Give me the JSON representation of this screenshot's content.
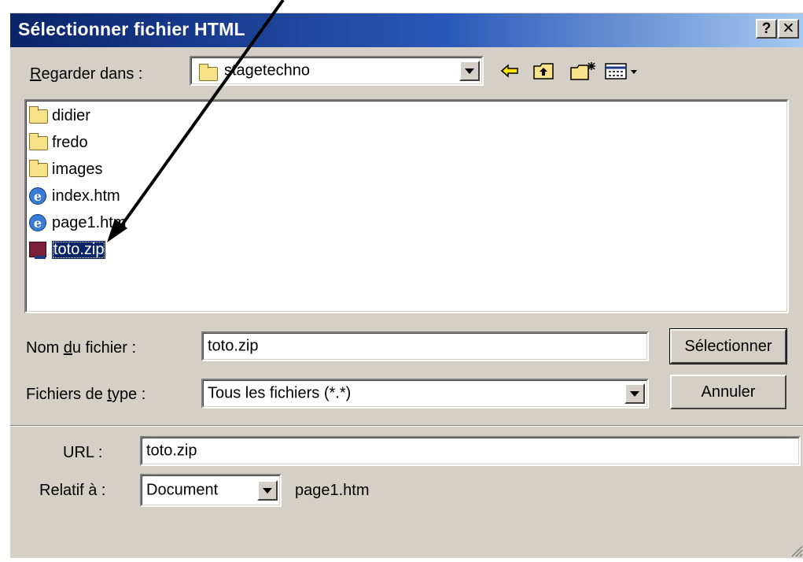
{
  "window": {
    "title": "Sélectionner fichier HTML",
    "help_button": "?",
    "close_button": "✕"
  },
  "look_in": {
    "label_prefix": "R",
    "label_rest": "egarder dans :",
    "value": "stagetechno"
  },
  "toolbar": {
    "back_icon": "back-arrow-icon",
    "up_icon": "up-folder-icon",
    "new_folder_icon": "new-folder-icon",
    "view_icon": "view-menu-icon"
  },
  "files": [
    {
      "name": "didier",
      "type": "folder"
    },
    {
      "name": "fredo",
      "type": "folder"
    },
    {
      "name": "images",
      "type": "folder"
    },
    {
      "name": "index.htm",
      "type": "html"
    },
    {
      "name": "page1.htm",
      "type": "html"
    },
    {
      "name": "toto.zip",
      "type": "zip",
      "selected": true
    }
  ],
  "filename": {
    "label_a": "Nom ",
    "label_ul": "d",
    "label_b": "u fichier :",
    "value": "toto.zip"
  },
  "filetype": {
    "label_a": "Fichiers de ",
    "label_ul": "t",
    "label_b": "ype :",
    "value": "Tous les fichiers (*.*)"
  },
  "buttons": {
    "select": "Sélectionner",
    "cancel": "Annuler"
  },
  "url": {
    "label": "URL :",
    "value": "toto.zip"
  },
  "relative": {
    "label": "Relatif à :",
    "value": "Document",
    "file": "page1.htm"
  },
  "colors": {
    "title_bar": "#0a246a",
    "dialog_face": "#d4d0c8",
    "selection": "#0a246a"
  }
}
